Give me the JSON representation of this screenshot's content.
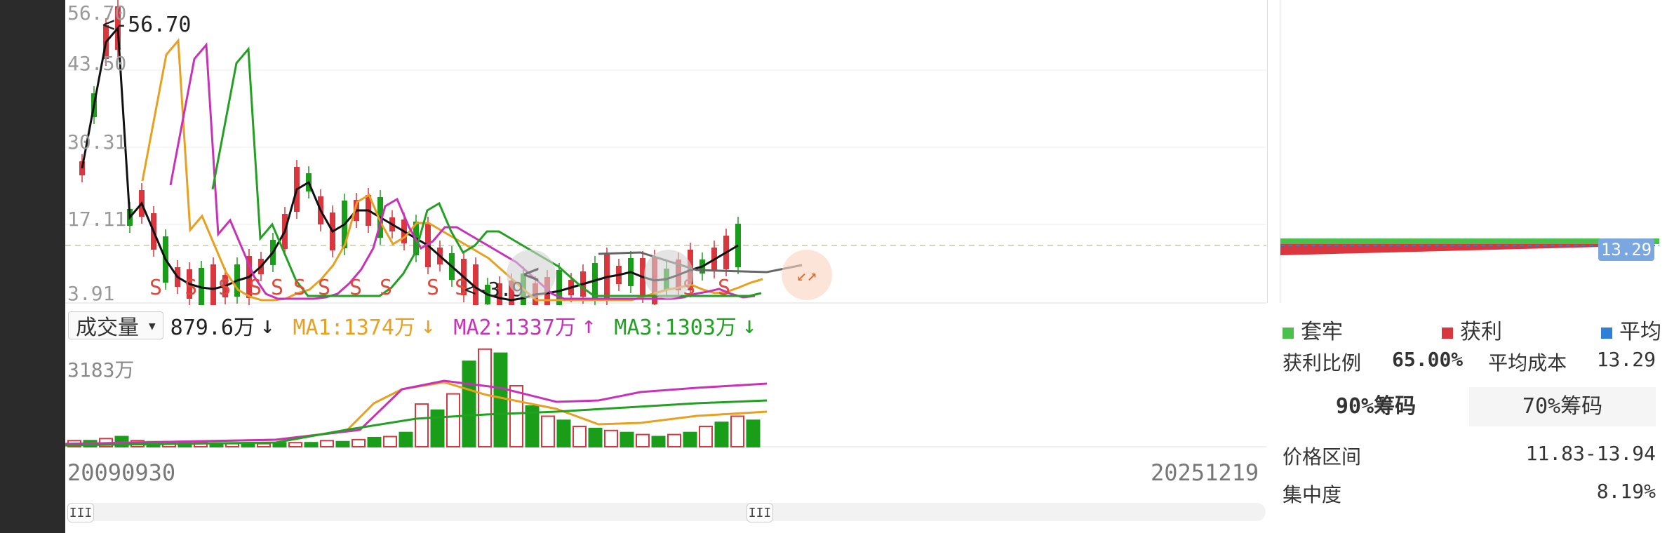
{
  "price_axis": {
    "max": "56.70",
    "label_2": "43.50",
    "label_3": "30.31",
    "label_4": "17.11",
    "min": "3.91"
  },
  "max_marker": "<-56.70",
  "min_marker": "<-3.9",
  "volume_selector": {
    "label": "成交量"
  },
  "indicators": {
    "vol": "879.6万",
    "vol_arrow": "↓",
    "ma1": "MA1:1374万",
    "ma1_arrow": "↓",
    "ma2": "MA2:1337万",
    "ma2_arrow": "↑",
    "ma3": "MA3:1303万",
    "ma3_arrow": "↓"
  },
  "volume_axis_max": "3183万",
  "dates": {
    "start": "20090930",
    "end": "20251219"
  },
  "slider": {
    "handle_glyph": "III"
  },
  "chip_marker_value": "13.29",
  "chip_legend": {
    "trapped": "套牢",
    "profit": "获利",
    "average": "平均"
  },
  "chip_stats": {
    "profit_ratio_label": "获利比例",
    "profit_ratio_value": "65.00%",
    "avg_cost_label": "平均成本",
    "avg_cost_value": "13.29"
  },
  "chip_tabs": [
    {
      "label": "90%筹码"
    },
    {
      "label": "70%筹码"
    }
  ],
  "chip_detail": {
    "range_label": "价格区间",
    "range_value": "11.83-13.94",
    "concentration_label": "集中度",
    "concentration_value": "8.19%"
  },
  "marker_glyph": "S",
  "nav_glyph": "<",
  "collapse_glyph": "↙↗",
  "colors": {
    "up": "#d9363e",
    "down": "#1a9e1a",
    "ma1": "#e8a020",
    "ma2": "#c832b8",
    "ma3": "#22a022",
    "avg": "#2f7fd8",
    "chip_marker_bg": "#7aa7df"
  }
}
